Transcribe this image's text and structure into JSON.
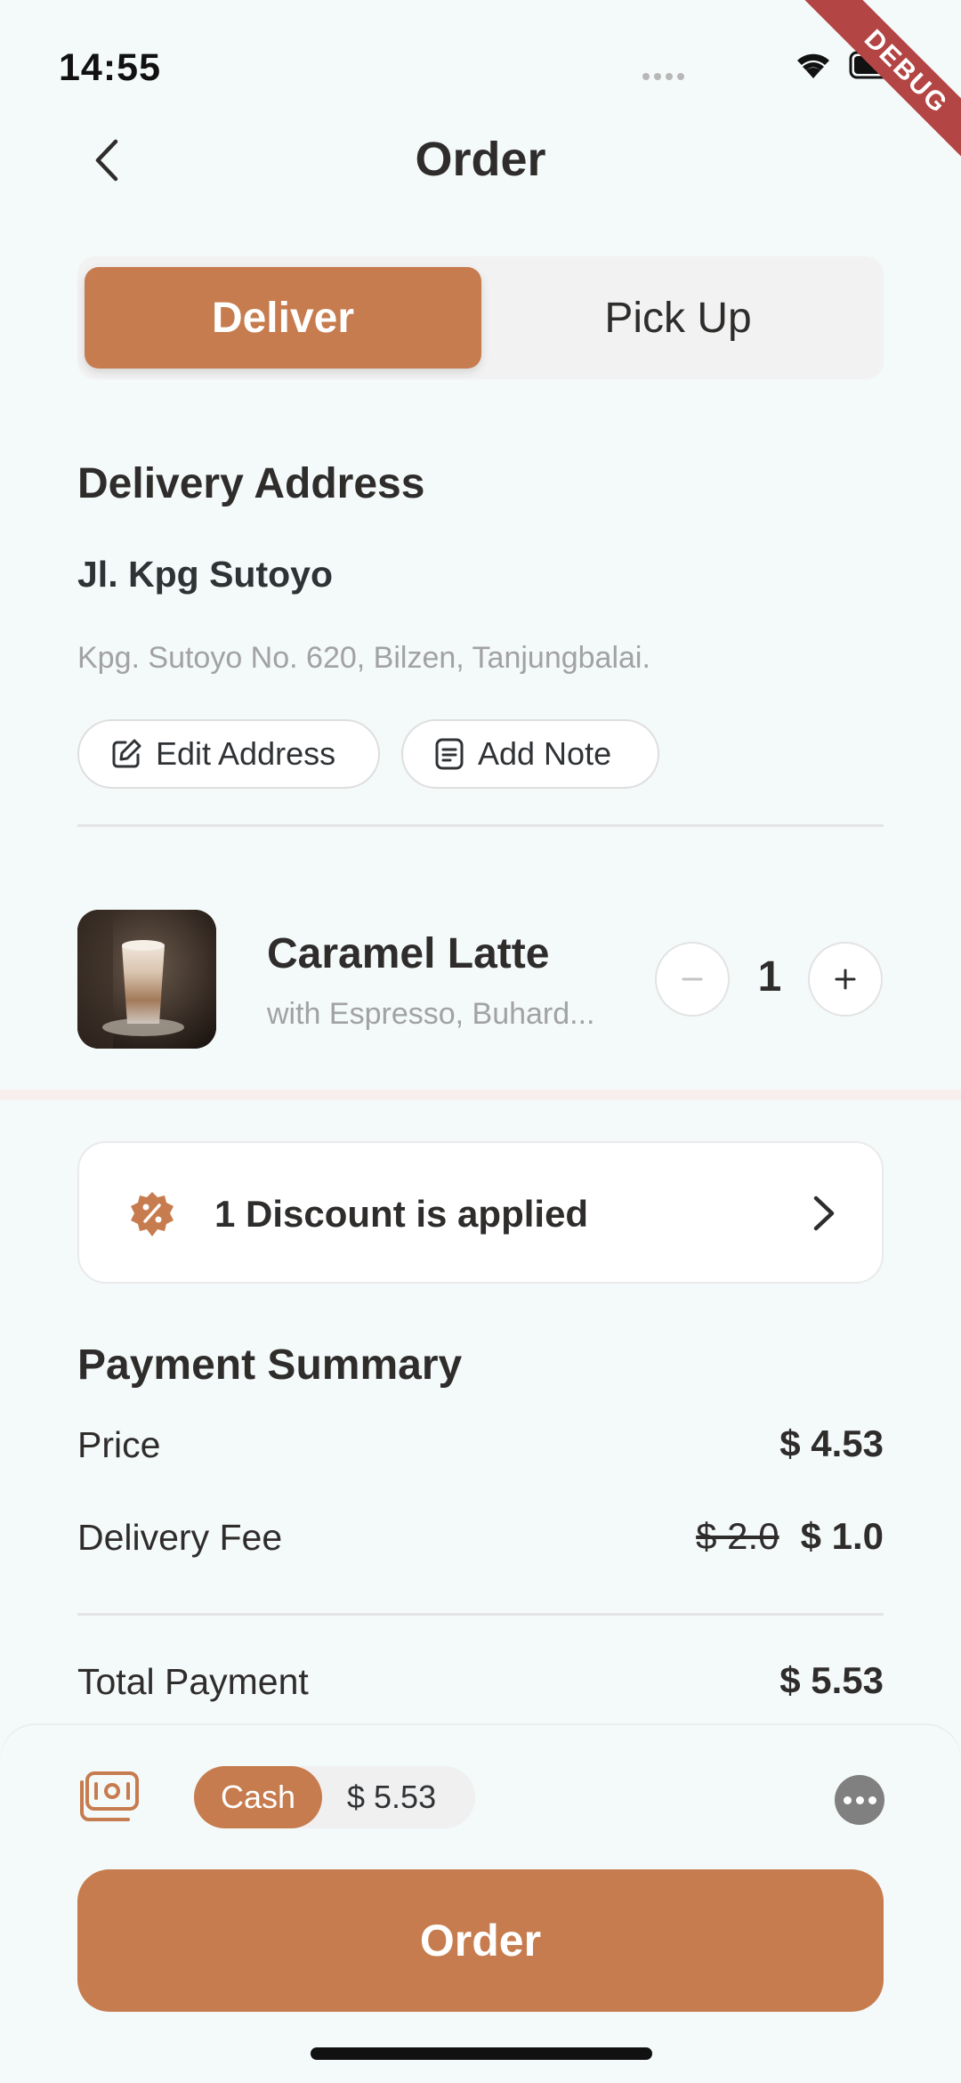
{
  "status_bar": {
    "time": "14:55",
    "debug_label": "DEBUG"
  },
  "header": {
    "title": "Order"
  },
  "delivery_toggle": {
    "options": [
      "Deliver",
      "Pick Up"
    ],
    "selected": "Deliver"
  },
  "address": {
    "section_title": "Delivery Address",
    "name": "Jl. Kpg Sutoyo",
    "detail": "Kpg. Sutoyo No. 620, Bilzen, Tanjungbalai.",
    "edit_label": "Edit Address",
    "note_label": "Add Note"
  },
  "cart_item": {
    "name": "Caramel Latte",
    "description": "with Espresso, Buhard...",
    "quantity": "1"
  },
  "discount": {
    "label": "1 Discount is applied"
  },
  "payment_summary": {
    "title": "Payment Summary",
    "price_label": "Price",
    "price_value": "$ 4.53",
    "delivery_label": "Delivery Fee",
    "delivery_original": "$ 2.0",
    "delivery_value": "$ 1.0",
    "total_label": "Total Payment",
    "total_value": "$ 5.53"
  },
  "bottom_bar": {
    "method": "Cash",
    "amount": "$ 5.53",
    "order_label": "Order"
  },
  "colors": {
    "accent": "#c67c4e",
    "background": "#f4f9f9",
    "text": "#2f2d2c",
    "muted": "#a2a2a2",
    "debug": "#b34544"
  },
  "icons": [
    "back-chevron-icon",
    "wifi-icon",
    "battery-icon",
    "edit-icon",
    "note-icon",
    "minus-icon",
    "plus-icon",
    "discount-badge-icon",
    "chevron-right-icon",
    "wallet-icon",
    "more-icon"
  ]
}
